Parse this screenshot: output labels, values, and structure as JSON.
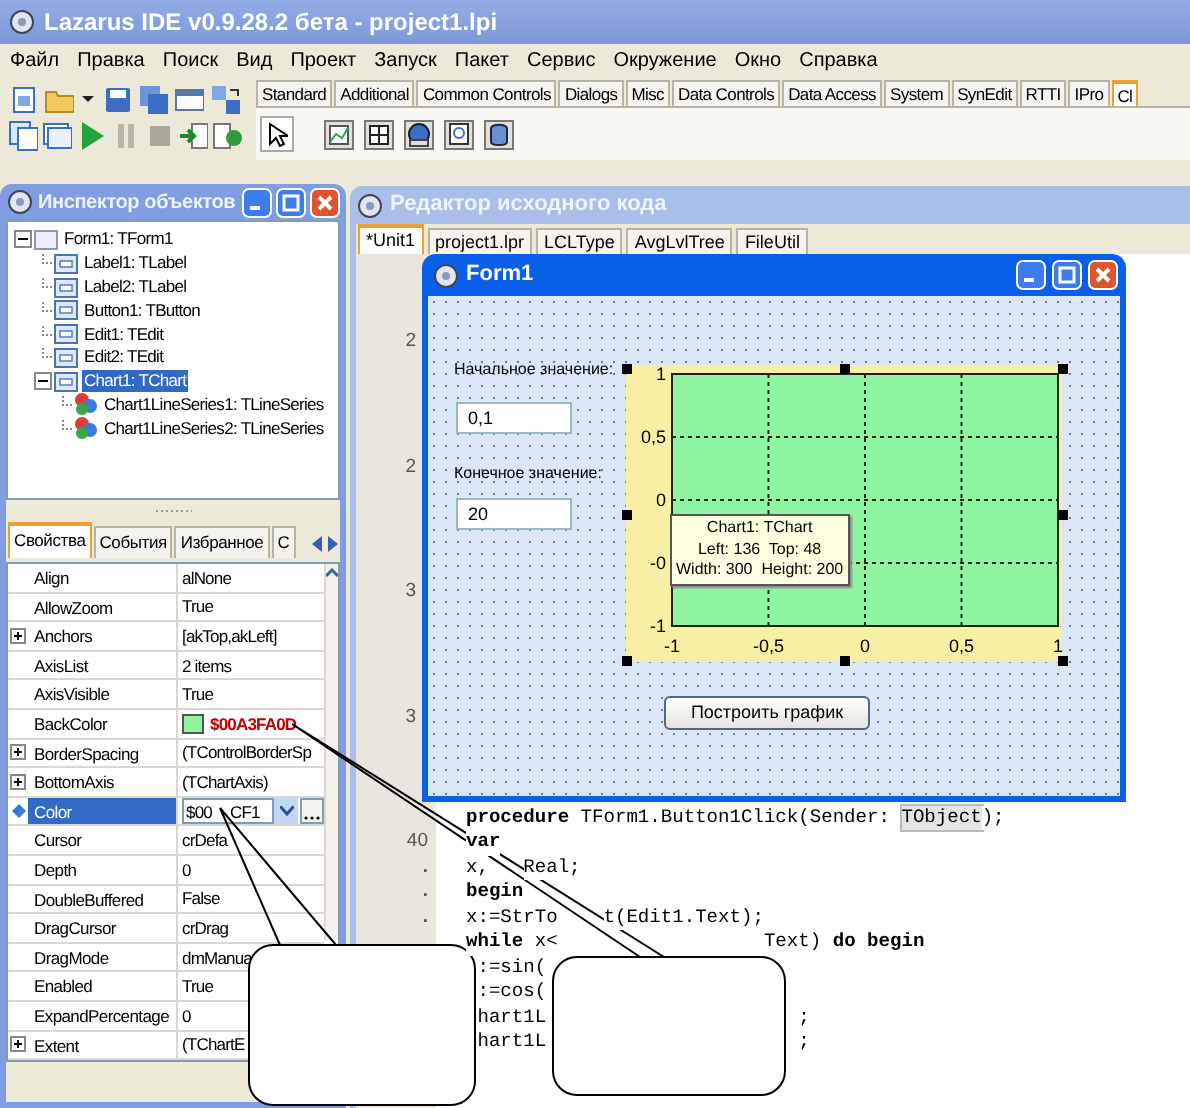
{
  "window": {
    "title": "Lazarus IDE v0.9.28.2 бета - project1.lpi"
  },
  "menu": [
    "Файл",
    "Правка",
    "Поиск",
    "Вид",
    "Проект",
    "Запуск",
    "Пакет",
    "Сервис",
    "Окружение",
    "Окно",
    "Справка"
  ],
  "palette": {
    "tabs": [
      {
        "label": "Standard",
        "selected": false
      },
      {
        "label": "Additional",
        "selected": false
      },
      {
        "label": "Common Controls",
        "selected": false
      },
      {
        "label": "Dialogs",
        "selected": false
      },
      {
        "label": "Misc",
        "selected": false
      },
      {
        "label": "Data Controls",
        "selected": false
      },
      {
        "label": "Data Access",
        "selected": false
      },
      {
        "label": "System",
        "selected": false
      },
      {
        "label": "SynEdit",
        "selected": false
      },
      {
        "label": "RTTI",
        "selected": false
      },
      {
        "label": "IPro",
        "selected": false
      },
      {
        "label": "Cl",
        "selected": true
      }
    ]
  },
  "object_inspector": {
    "title": "Инспектор объектов",
    "tree": [
      {
        "label": "Form1: TForm1",
        "kind": "form",
        "expanded": true,
        "selected": false,
        "children": [
          {
            "label": "Label1: TLabel",
            "kind": "control",
            "selected": false
          },
          {
            "label": "Label2: TLabel",
            "kind": "control",
            "selected": false
          },
          {
            "label": "Button1: TButton",
            "kind": "control",
            "selected": false
          },
          {
            "label": "Edit1: TEdit",
            "kind": "control",
            "selected": false
          },
          {
            "label": "Edit2: TEdit",
            "kind": "control",
            "selected": false
          },
          {
            "label": "Chart1: TChart",
            "kind": "control",
            "expanded": true,
            "selected": true,
            "children": [
              {
                "label": "Chart1LineSeries1: TLineSeries",
                "kind": "series",
                "selected": false
              },
              {
                "label": "Chart1LineSeries2: TLineSeries",
                "kind": "series",
                "selected": false
              }
            ]
          }
        ]
      }
    ],
    "tabs": [
      {
        "label": "Свойства",
        "selected": true
      },
      {
        "label": "События",
        "selected": false
      },
      {
        "label": "Избранное",
        "selected": false
      },
      {
        "label": "С",
        "selected": false
      }
    ],
    "properties": [
      {
        "name": "Align",
        "value": "alNone",
        "expandable": false,
        "selected": false,
        "kind": "text"
      },
      {
        "name": "AllowZoom",
        "value": "True",
        "expandable": false,
        "selected": false,
        "kind": "text"
      },
      {
        "name": "Anchors",
        "value": "[akTop,akLeft]",
        "expandable": true,
        "selected": false,
        "kind": "text"
      },
      {
        "name": "AxisList",
        "value": "2 items",
        "expandable": false,
        "selected": false,
        "kind": "text"
      },
      {
        "name": "AxisVisible",
        "value": "True",
        "expandable": false,
        "selected": false,
        "kind": "text"
      },
      {
        "name": "BackColor",
        "value": "$00A3FA0D",
        "expandable": false,
        "selected": false,
        "kind": "color",
        "color": "#8ff49b"
      },
      {
        "name": "BorderSpacing",
        "value": "(TControlBorderSp",
        "expandable": true,
        "selected": false,
        "kind": "text"
      },
      {
        "name": "BottomAxis",
        "value": "(TChartAxis)",
        "expandable": true,
        "selected": false,
        "kind": "text"
      },
      {
        "name": "Color",
        "value": "$00",
        "value_tail": "CF1",
        "expandable": false,
        "selected": true,
        "kind": "combo"
      },
      {
        "name": "Cursor",
        "value": "crDefa",
        "expandable": false,
        "selected": false,
        "kind": "text"
      },
      {
        "name": "Depth",
        "value": "0",
        "expandable": false,
        "selected": false,
        "kind": "text"
      },
      {
        "name": "DoubleBuffered",
        "value": "False",
        "expandable": false,
        "selected": false,
        "kind": "text"
      },
      {
        "name": "DragCursor",
        "value": "crDrag",
        "expandable": false,
        "selected": false,
        "kind": "text"
      },
      {
        "name": "DragMode",
        "value": "dmManua",
        "expandable": false,
        "selected": false,
        "kind": "text"
      },
      {
        "name": "Enabled",
        "value": "True",
        "expandable": false,
        "selected": false,
        "kind": "text"
      },
      {
        "name": "ExpandPercentage",
        "value": "0",
        "expandable": false,
        "selected": false,
        "kind": "text"
      },
      {
        "name": "Extent",
        "value": "(TChartE",
        "expandable": true,
        "selected": false,
        "kind": "text"
      }
    ]
  },
  "source_editor": {
    "title": "Редактор исходного кода",
    "tabs": [
      {
        "label": "*Unit1",
        "selected": true
      },
      {
        "label": "project1.lpr",
        "selected": false
      },
      {
        "label": "LCLType",
        "selected": false
      },
      {
        "label": "AvgLvlTree",
        "selected": false
      },
      {
        "label": "FileUtil",
        "selected": false
      }
    ],
    "rows": [
      {
        "mark": {
          "kind": "digit",
          "text": "2"
        }
      },
      {},
      {},
      {},
      {},
      {
        "mark": {
          "kind": "digit",
          "text": "2"
        }
      },
      {},
      {},
      {},
      {},
      {
        "mark": {
          "kind": "digit",
          "text": "3"
        }
      },
      {},
      {},
      {},
      {},
      {
        "mark": {
          "kind": "digit",
          "text": "3"
        }
      },
      {},
      {},
      {},
      {
        "segments": [
          {
            "text": "procedure",
            "kind": "keyword"
          },
          {
            "text": " TForm1.Button1Click(Sender: ",
            "kind": "plain"
          },
          {
            "text": "TObject",
            "kind": "highlight"
          },
          {
            "text": ");",
            "kind": "plain"
          }
        ]
      },
      {
        "mark": {
          "kind": "number",
          "text": "40"
        },
        "segments": [
          {
            "text": "var",
            "kind": "keyword"
          }
        ]
      },
      {
        "mark": {
          "kind": "dot",
          "text": "."
        },
        "segments": [
          {
            "text": "x,",
            "kind": "plain"
          },
          {
            "text": "Real;",
            "kind": "plain"
          }
        ]
      },
      {
        "mark": {
          "kind": "dot",
          "text": "."
        },
        "segments": [
          {
            "text": "begin",
            "kind": "keyword"
          }
        ]
      },
      {
        "mark": {
          "kind": "dot",
          "text": "."
        },
        "segments": [
          {
            "text": "x:=StrTo",
            "kind": "plain"
          },
          {
            "text": "t(Edit1.Text);",
            "kind": "plain"
          }
        ]
      },
      {
        "segments": [
          {
            "text": "while",
            "kind": "keyword"
          },
          {
            "text": " x<",
            "kind": "plain"
          },
          {
            "text": "Text)",
            "kind": "plain"
          },
          {
            "text": " do begin",
            "kind": "keyword"
          }
        ]
      },
      {
        "segments": [
          {
            "text": ":=sin(",
            "kind": "plain"
          }
        ]
      },
      {
        "segments": [
          {
            "text": ":=cos(",
            "kind": "plain"
          }
        ]
      },
      {
        "segments": [
          {
            "text": "hart1L",
            "kind": "plain"
          },
          {
            "text": ";",
            "kind": "plain"
          }
        ]
      },
      {
        "segments": [
          {
            "text": "hart1L",
            "kind": "plain"
          },
          {
            "text": ";",
            "kind": "plain"
          }
        ]
      }
    ]
  },
  "form": {
    "title": "Form1",
    "start_label": "Начальное значение:",
    "start_value": "0,1",
    "end_label": "Конечное значение:",
    "end_value": "20",
    "button": "Построить график",
    "chart": {
      "chart_data": {
        "type": "line",
        "xlim": [
          -1,
          1
        ],
        "ylim": [
          -1,
          1
        ],
        "grid": true,
        "xticks": [
          {
            "value": -1,
            "label": "-1"
          },
          {
            "value": -0.5,
            "label": "-0,5"
          },
          {
            "value": 0,
            "label": "0"
          },
          {
            "value": 0.5,
            "label": "0,5"
          },
          {
            "value": 1,
            "label": "1"
          }
        ],
        "yticks": [
          {
            "value": -1,
            "label": "-1"
          },
          {
            "value": -0.5,
            "label": "-0"
          },
          {
            "value": 0,
            "label": "0"
          },
          {
            "value": 0.5,
            "label": "0,5"
          },
          {
            "value": 1,
            "label": "1"
          }
        ]
      }
    },
    "hint": [
      "Chart1: TChart",
      "Left: 136  Top: 48",
      "Width: 300  Height: 200"
    ]
  }
}
